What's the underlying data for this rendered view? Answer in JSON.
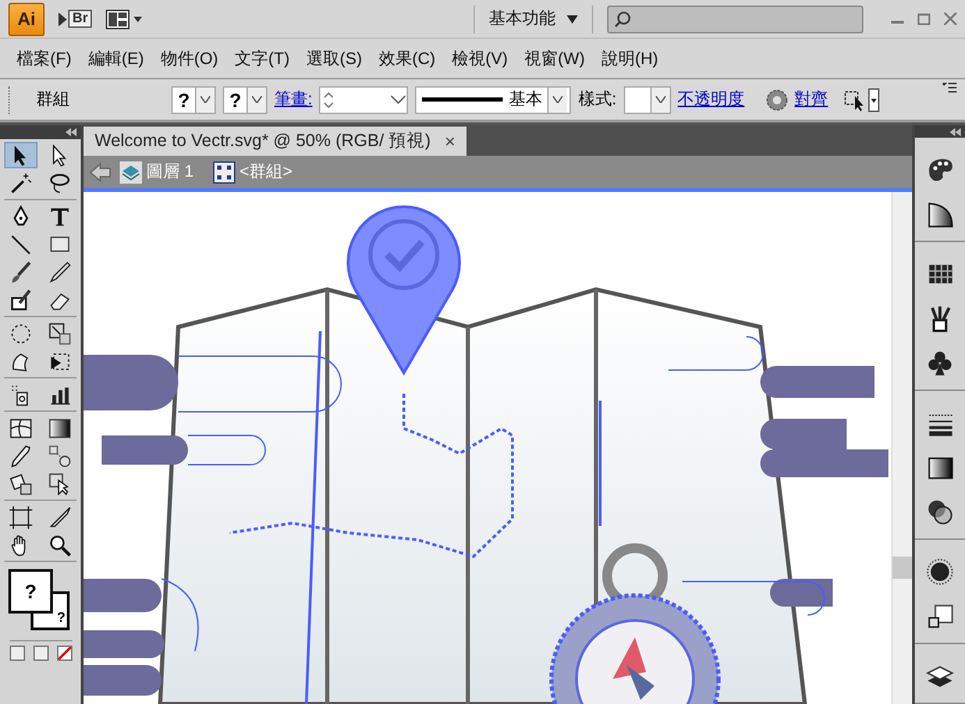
{
  "app_bar": {
    "logo": "Ai",
    "bridge": "Br",
    "workspace": "基本功能"
  },
  "menu": [
    "檔案(F)",
    "編輯(E)",
    "物件(O)",
    "文字(T)",
    "選取(S)",
    "效果(C)",
    "檢視(V)",
    "視窗(W)",
    "說明(H)"
  ],
  "control_bar": {
    "selection": "群組",
    "fill": "?",
    "stroke": "?",
    "stroke_link": "筆畫:",
    "stroke_style": "基本",
    "style_label": "樣式:",
    "opacity_link": "不透明度",
    "align_link": "對齊"
  },
  "document_tab": {
    "title": "Welcome to Vectr.svg* @ 50% (RGB/ 預視)",
    "close": "×"
  },
  "breadcrumb": {
    "layer": "圖層 1",
    "group": "<群組>"
  },
  "tool_groups": [
    [
      {
        "kind": "selection",
        "selected": true
      },
      {
        "kind": "direct-selection",
        "selected": false
      },
      {
        "kind": "magic-wand",
        "selected": false
      },
      {
        "kind": "lasso",
        "selected": false
      }
    ],
    [
      {
        "kind": "pen",
        "selected": false
      },
      {
        "kind": "type",
        "selected": false
      },
      {
        "kind": "line",
        "selected": false
      },
      {
        "kind": "rectangle",
        "selected": false
      },
      {
        "kind": "paintbrush",
        "selected": false
      },
      {
        "kind": "pencil",
        "selected": false
      },
      {
        "kind": "blob-brush",
        "selected": false
      },
      {
        "kind": "eraser",
        "selected": false
      }
    ],
    [
      {
        "kind": "rotate",
        "selected": false
      },
      {
        "kind": "scale",
        "selected": false
      },
      {
        "kind": "warp",
        "selected": false
      },
      {
        "kind": "free-transform",
        "selected": false
      }
    ],
    [
      {
        "kind": "sprayer",
        "selected": false
      },
      {
        "kind": "graph",
        "selected": false
      }
    ],
    [
      {
        "kind": "mesh",
        "selected": false
      },
      {
        "kind": "gradient",
        "selected": false
      },
      {
        "kind": "eyedropper",
        "selected": false
      },
      {
        "kind": "blend",
        "selected": false
      },
      {
        "kind": "live-paint",
        "selected": false
      },
      {
        "kind": "live-paint-select",
        "selected": false
      }
    ],
    [
      {
        "kind": "artboard",
        "selected": false
      },
      {
        "kind": "slice",
        "selected": false
      },
      {
        "kind": "hand",
        "selected": false
      },
      {
        "kind": "zoom",
        "selected": false
      }
    ]
  ],
  "fill_stroke": {
    "fill": "?",
    "stroke": "?"
  }
}
